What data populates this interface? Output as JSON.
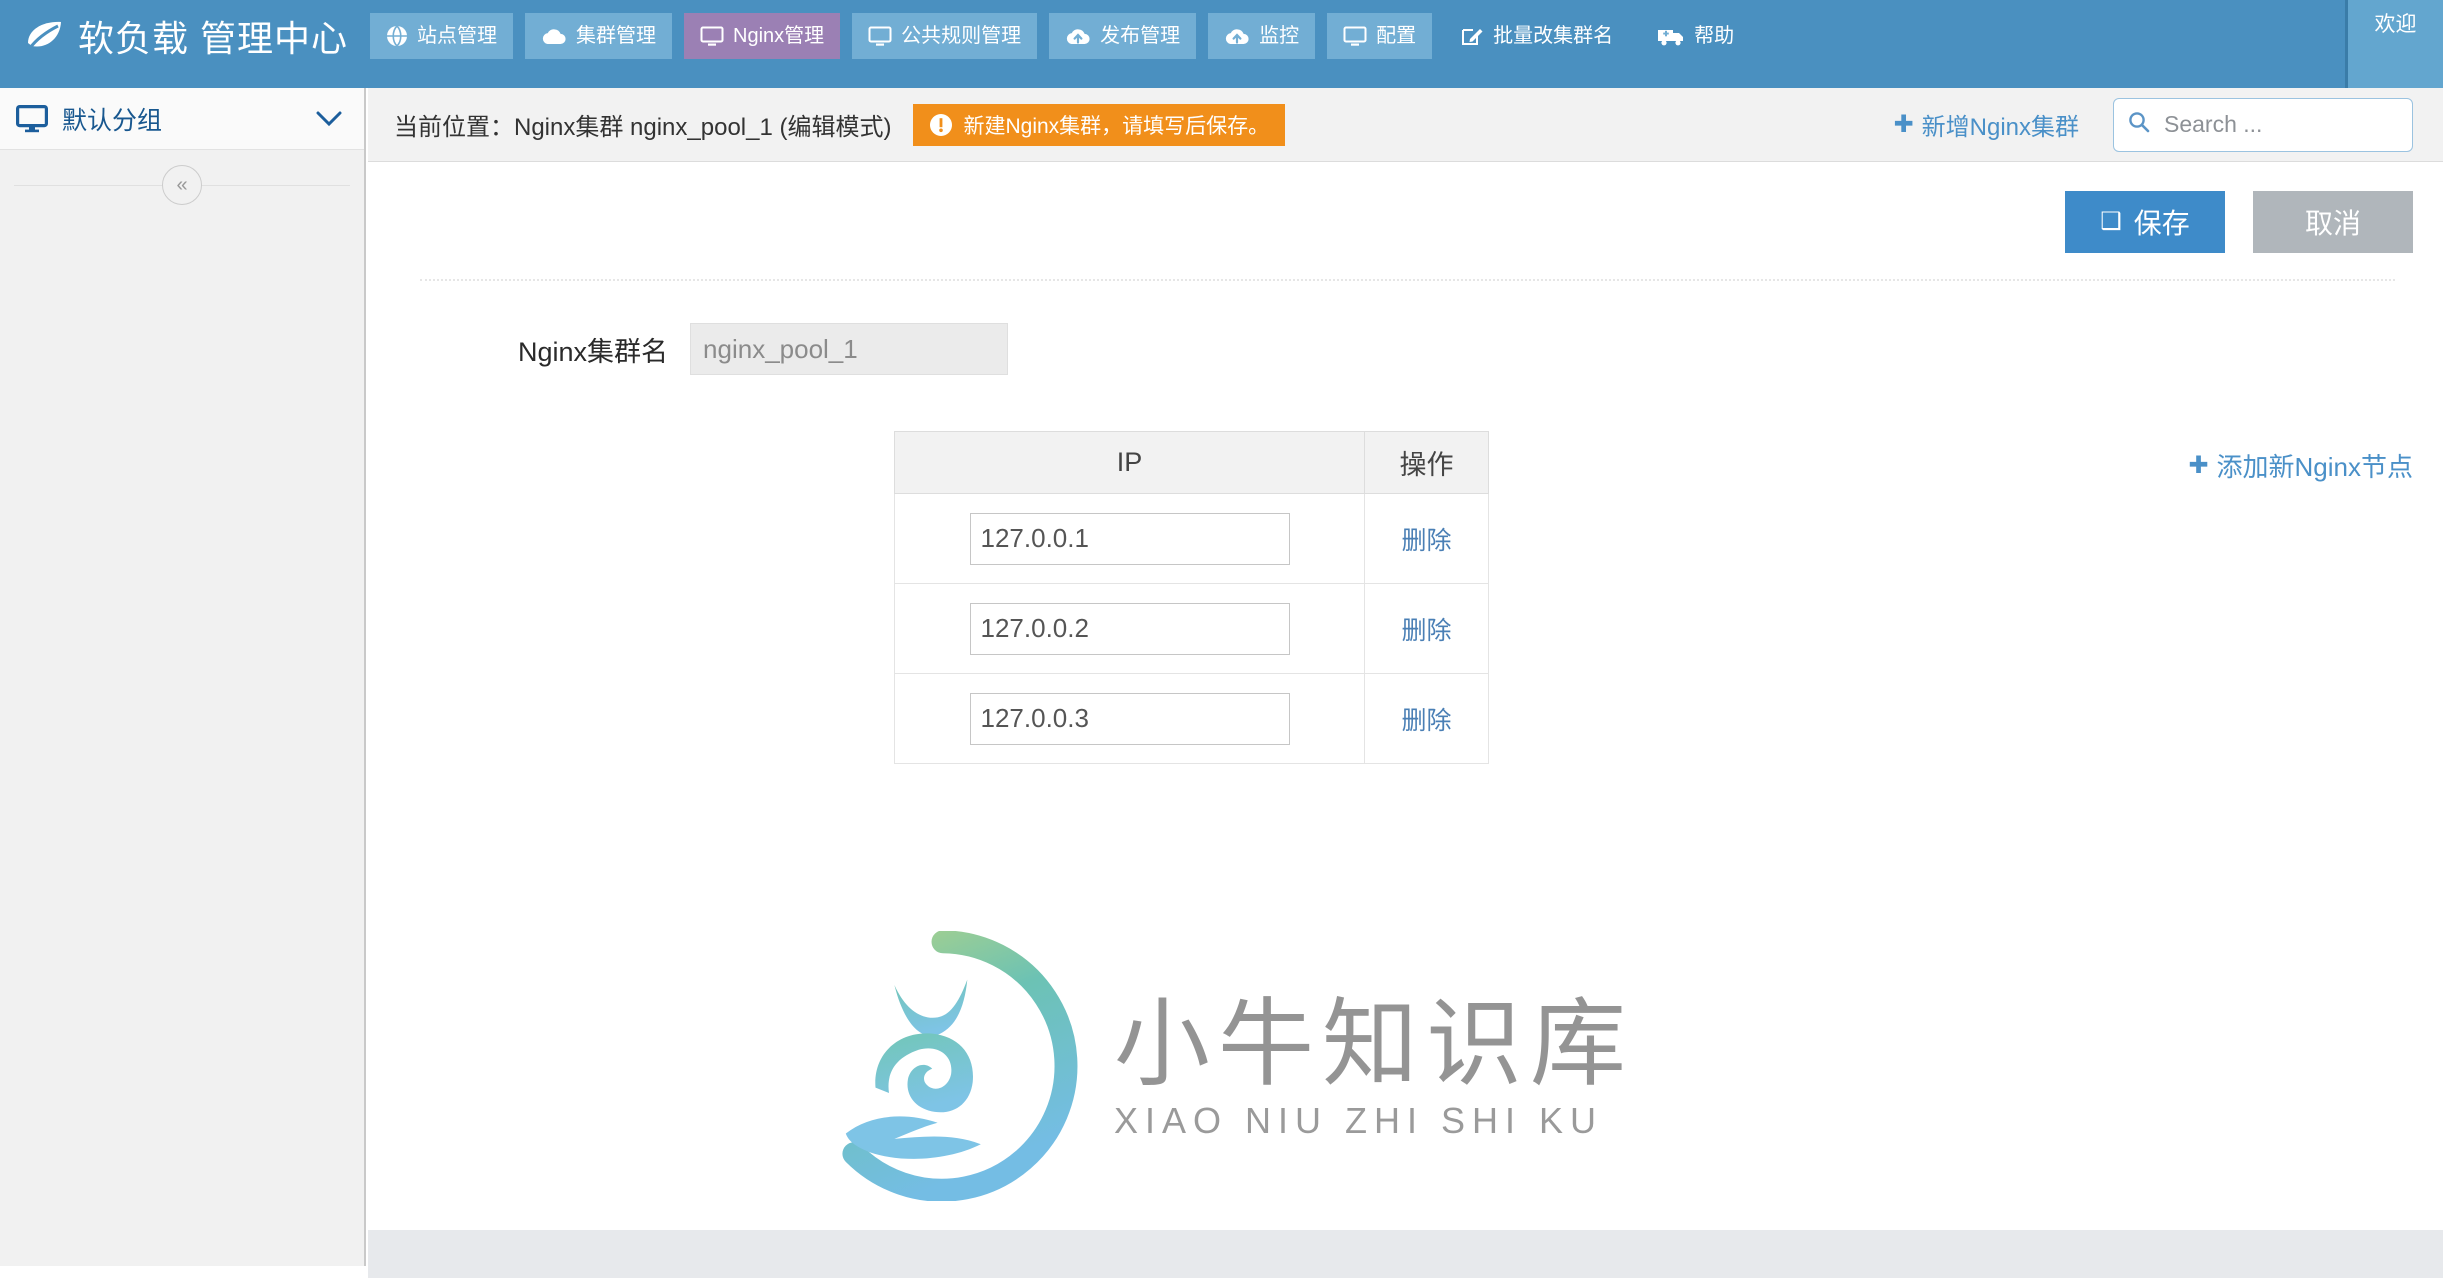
{
  "app": {
    "brand": "软负载 管理中心",
    "brand_icon": "leaf-icon",
    "accent_blue": "#4a90c0",
    "active_nav_color": "#9b80b4",
    "alert_orange": "#f18f1b"
  },
  "topnav": {
    "items": [
      {
        "label": "站点管理",
        "icon": "globe-icon",
        "active": false
      },
      {
        "label": "集群管理",
        "icon": "cloud-icon",
        "active": false
      },
      {
        "label": "Nginx管理",
        "icon": "monitor-icon",
        "active": true
      },
      {
        "label": "公共规则管理",
        "icon": "monitor-icon",
        "active": false
      },
      {
        "label": "发布管理",
        "icon": "cloud-upload-icon",
        "active": false
      },
      {
        "label": "监控",
        "icon": "cloud-upload-icon",
        "active": false
      },
      {
        "label": "配置",
        "icon": "monitor-icon",
        "active": false
      },
      {
        "label": "批量改集群名",
        "icon": "edit-square-icon",
        "active": false
      },
      {
        "label": "帮助",
        "icon": "ambulance-icon",
        "active": false
      }
    ],
    "welcome": "欢迎"
  },
  "sidebar": {
    "group": {
      "label": "默认分组",
      "icon": "desktop-icon",
      "chevron": "chevron-down-icon"
    },
    "collapse_glyph": "«"
  },
  "subheader": {
    "breadcrumb": "当前位置：Nginx集群 nginx_pool_1 (编辑模式)",
    "alert": {
      "icon": "exclamation-circle-icon",
      "text": "新建Nginx集群，请填写后保存。"
    },
    "add_cluster": {
      "plus": "✚",
      "label": "新增Nginx集群"
    },
    "search": {
      "icon": "search-icon",
      "placeholder": "Search ...",
      "value": ""
    }
  },
  "main": {
    "buttons": {
      "save_glyph": "❑",
      "save_label": "保存",
      "cancel_label": "取消"
    },
    "cluster_name_field": {
      "label": "Nginx集群名",
      "value": "nginx_pool_1",
      "placeholder": ""
    },
    "add_node": {
      "plus": "✚",
      "label": "添加新Nginx节点"
    },
    "table": {
      "columns": [
        "IP",
        "操作"
      ],
      "rows": [
        {
          "ip": "127.0.0.1",
          "action": "删除"
        },
        {
          "ip": "127.0.0.2",
          "action": "删除"
        },
        {
          "ip": "127.0.0.3",
          "action": "删除"
        }
      ]
    }
  },
  "watermark": {
    "cn": "小牛知识库",
    "en": "XIAO NIU ZHI SHI KU",
    "logo": "bull-ring-logo"
  }
}
